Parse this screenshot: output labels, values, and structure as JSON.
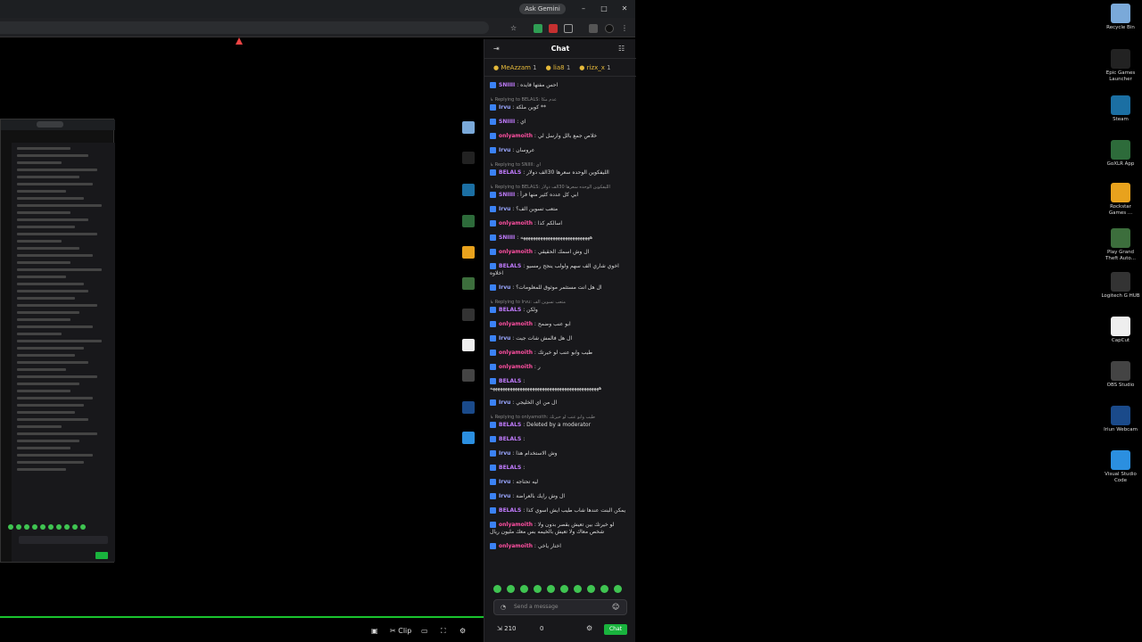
{
  "browser": {
    "ask_gemini": "Ask Gemini",
    "window_controls": {
      "minimize": "–",
      "maximize": "□",
      "close": "✕"
    }
  },
  "chat": {
    "title": "Chat",
    "pinned": [
      {
        "name": "MeAzzam",
        "count": "1"
      },
      {
        "name": "lia8",
        "count": "1"
      },
      {
        "name": "rizx_x",
        "count": "1"
      }
    ],
    "messages": [
      {
        "reply": "",
        "user": "SNIIII",
        "color": "#c27cff",
        "text": ": احس مفتها فايده"
      },
      {
        "reply": "Replying to BELALS: عدم مكا",
        "user": "Irvu",
        "color": "#9aa7ff",
        "text": ": كوين ملكة **"
      },
      {
        "reply": "",
        "user": "SNIIII",
        "color": "#c27cff",
        "text": ": اي"
      },
      {
        "reply": "",
        "user": "onlyamoith",
        "color": "#ff4fa1",
        "text": ": خلاص جمع بالل وارسل لي"
      },
      {
        "reply": "",
        "user": "Irvu",
        "color": "#9aa7ff",
        "text": ": عروسان"
      },
      {
        "reply": "Replying to SNIIII: اي",
        "user": "BELALS",
        "color": "#c27cff",
        "text": ": الليفكوين الوحده سعرها 30الف دولار"
      },
      {
        "reply": "Replying to BELALS: الليفكوين الوحده سعرها 30الف دولار",
        "user": "SNIIII",
        "color": "#c27cff",
        "text": ": ابي كل عدده كثير منها فرأ"
      },
      {
        "reply": "",
        "user": "Irvu",
        "color": "#9aa7ff",
        "text": ": متعب تسوين الف؟"
      },
      {
        "reply": "",
        "user": "onlyamoith",
        "color": "#ff4fa1",
        "text": ": اسالكم كذا"
      },
      {
        "reply": "",
        "user": "SNIIII",
        "color": "#c27cff",
        "text": ": ههههههههههههههههههههههههههههه"
      },
      {
        "reply": "",
        "user": "onlyamoith",
        "color": "#ff4fa1",
        "text": ": ال وش اسمك الحقيقي"
      },
      {
        "reply": "",
        "user": "BELALS",
        "color": "#c27cff",
        "text": ": اخوي شاري الف سهم ولولب ينجح رمسيو اخلاوه"
      },
      {
        "reply": "",
        "user": "Irvu",
        "color": "#9aa7ff",
        "text": ": ال هل انت مستثمر موثوق للمعلومات؟"
      },
      {
        "reply": "Replying to Irvu: متعب تسوين الف",
        "user": "BELALS",
        "color": "#c27cff",
        "text": ": ولكن"
      },
      {
        "reply": "",
        "user": "onlyamoith",
        "color": "#ff4fa1",
        "text": ": ابو عنب وضمح"
      },
      {
        "reply": "",
        "user": "Irvu",
        "color": "#9aa7ff",
        "text": ": ال هل فالمش شات جيت"
      },
      {
        "reply": "",
        "user": "onlyamoith",
        "color": "#ff4fa1",
        "text": ": طيب وابو عنب لو خيرتك"
      },
      {
        "reply": "",
        "user": "onlyamoith",
        "color": "#ff4fa1",
        "text": ": ر"
      },
      {
        "reply": "",
        "user": "BELALS",
        "color": "#c27cff",
        "text": ": ههههههههههههههههههههههههههههههههههههههههههههه"
      },
      {
        "reply": "",
        "user": "Irvu",
        "color": "#9aa7ff",
        "text": ": ال من اي الخليجي"
      },
      {
        "reply": "Replying to onlyamoith: طيب وابو عنب لو خيرتك",
        "user": "BELALS",
        "color": "#c27cff",
        "text": ": Deleted by a moderator"
      },
      {
        "reply": "",
        "user": "BELALS",
        "color": "#c27cff",
        "text": ":"
      },
      {
        "reply": "",
        "user": "Irvu",
        "color": "#9aa7ff",
        "text": ": وش الاستخدام هذا"
      },
      {
        "reply": "",
        "user": "BELALS",
        "color": "#c27cff",
        "text": ":"
      },
      {
        "reply": "",
        "user": "Irvu",
        "color": "#9aa7ff",
        "text": ": ليه تحتاجه"
      },
      {
        "reply": "",
        "user": "Irvu",
        "color": "#9aa7ff",
        "text": ": ال وش رايك بالعراضة"
      },
      {
        "reply": "",
        "user": "BELALS",
        "color": "#c27cff",
        "text": ": يمكن البنت عندها شاب طيب ايش اسوي كذا"
      },
      {
        "reply": "",
        "user": "onlyamoith",
        "color": "#ff4fa1",
        "text": ": لو خيرتك بين تعيش بقصر بدون ولا شخص معاك ولا تعيش بالخيمه بس معك مليون ريال"
      },
      {
        "reply": "",
        "user": "onlyamoith",
        "color": "#ff4fa1",
        "text": ": اختار ياخي"
      }
    ],
    "input_placeholder": "Send a message",
    "points": "210",
    "zero": "0",
    "chat_button": "Chat"
  },
  "bottom_bar": {
    "clip_label": "Clip"
  },
  "desktop_icons": [
    {
      "label": "Recycle Bin",
      "color": "#7aa9d9"
    },
    {
      "label": "Epic Games Launcher",
      "color": "#222222"
    },
    {
      "label": "Steam",
      "color": "#1b6fa3"
    },
    {
      "label": "GoXLR App",
      "color": "#2d6b3a"
    },
    {
      "label": "Rockstar Games ...",
      "color": "#e8a21d"
    },
    {
      "label": "Play Grand Theft Auto...",
      "color": "#3c6e3c"
    },
    {
      "label": "Logitech G HUB",
      "color": "#333333"
    },
    {
      "label": "CapCut",
      "color": "#eeeeee"
    },
    {
      "label": "OBS Studio",
      "color": "#444444"
    },
    {
      "label": "Iriun Webcam",
      "color": "#1a4a8a"
    },
    {
      "label": "Visual Studio Code",
      "color": "#2b8fe0"
    }
  ]
}
